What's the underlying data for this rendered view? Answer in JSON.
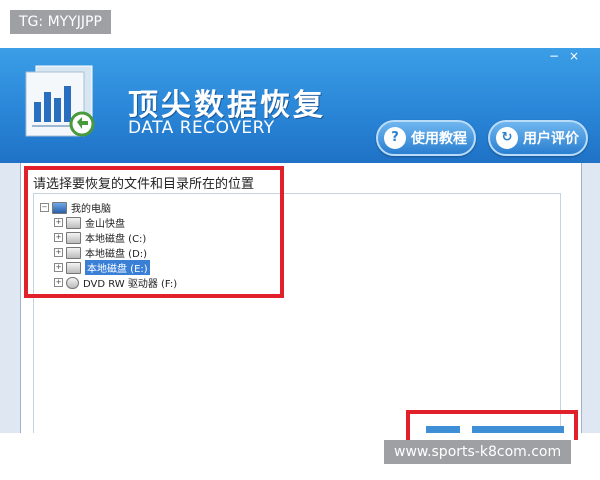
{
  "watermark_top": "TG: MYYJJPP",
  "watermark_bottom": "www.sports-k8com.com",
  "window": {
    "minimize_glyph": "−",
    "close_glyph": "×"
  },
  "app": {
    "title_cn": "顶尖数据恢复",
    "title_en": "DATA RECOVERY",
    "logo_icon": "bar-chart-document-icon"
  },
  "buttons": [
    {
      "label": "使用教程",
      "icon": "question-icon",
      "glyph": "?"
    },
    {
      "label": "用户评价",
      "icon": "refresh-icon",
      "glyph": "↻"
    }
  ],
  "main": {
    "prompt": "请选择要恢复的文件和目录所在的位置",
    "tree": {
      "root": {
        "label": "我的电脑",
        "expander": "−",
        "icon": "computer-icon"
      },
      "items": [
        {
          "label": "金山快盘",
          "expander": "+",
          "icon": "cloud-drive-icon"
        },
        {
          "label": "本地磁盘 (C:)",
          "expander": "+",
          "icon": "hard-drive-icon"
        },
        {
          "label": "本地磁盘 (D:)",
          "expander": "+",
          "icon": "hard-drive-icon"
        },
        {
          "label": "本地磁盘 (E:)",
          "expander": "+",
          "icon": "hard-drive-icon",
          "selected": true
        },
        {
          "label": "DVD RW 驱动器 (F:)",
          "expander": "+",
          "icon": "dvd-drive-icon"
        }
      ]
    }
  },
  "colors": {
    "titlebar": "#2a86d8",
    "highlight": "#e0202a",
    "selection": "#3a7fd6"
  }
}
